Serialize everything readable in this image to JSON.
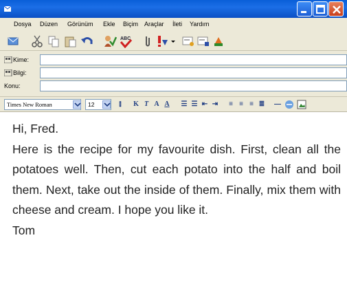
{
  "menu": [
    "Dosya",
    "Düzen",
    "Görünüm",
    "Ekle",
    "Biçim",
    "Araçlar",
    "İleti",
    "Yardım"
  ],
  "fields": {
    "to_label": "Kime:",
    "cc_label": "Bilgi:",
    "subject_label": "Konu:"
  },
  "format": {
    "font": "Times New Roman",
    "size": "12"
  },
  "message": {
    "greeting": "Hi, Fred.",
    "body": "Here is the recipe for my favourite dish. First, clean all the potatoes well. Then, cut each potato into the half and boil them. Next, take out the inside of them. Finally, mix them with cheese and cream. I hope you like it.",
    "signature": "Tom"
  },
  "icons": {
    "toolbar": [
      "send-icon",
      "cut-icon",
      "copy-icon",
      "paste-icon",
      "undo-icon",
      "check-names-icon",
      "spelling-icon",
      "attach-icon",
      "priority-icon",
      "sign-icon",
      "encrypt-icon",
      "offline-icon"
    ],
    "format": [
      "paragraph-style-icon",
      "bold-icon",
      "italic-icon",
      "underline-icon",
      "font-color-icon",
      "numbering-icon",
      "bullets-icon",
      "decrease-indent-icon",
      "increase-indent-icon",
      "align-left-icon",
      "align-center-icon",
      "align-right-icon",
      "justify-icon",
      "horizontal-line-icon",
      "hyperlink-icon",
      "picture-icon"
    ]
  }
}
